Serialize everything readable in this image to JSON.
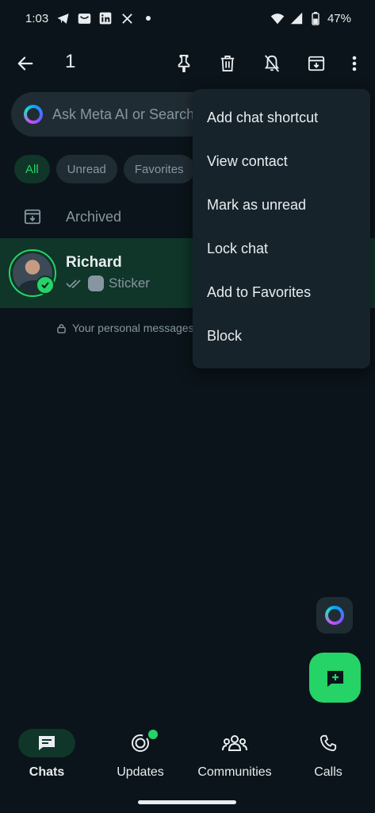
{
  "status_bar": {
    "time": "1:03",
    "battery": "47%",
    "notification_icons": [
      "telegram-icon",
      "mail-icon",
      "linkedin-icon",
      "x-icon",
      "dot-icon"
    ]
  },
  "action_bar": {
    "selected_count": "1",
    "actions": [
      "back-icon",
      "pin-icon",
      "delete-icon",
      "mute-icon",
      "archive-icon",
      "more-icon"
    ]
  },
  "search": {
    "placeholder": "Ask Meta AI or Search"
  },
  "filters": [
    "All",
    "Unread",
    "Favorites"
  ],
  "archived": {
    "label": "Archived"
  },
  "chat": {
    "name": "Richard",
    "preview": "Sticker"
  },
  "encryption_note": "Your personal messages",
  "menu": {
    "items": [
      "Add chat shortcut",
      "View contact",
      "Mark as unread",
      "Lock chat",
      "Add to Favorites",
      "Block"
    ]
  },
  "bottom_nav": {
    "items": [
      "Chats",
      "Updates",
      "Communities",
      "Calls"
    ]
  },
  "colors": {
    "background": "#0b141a",
    "accent": "#25d366",
    "selected_row": "#103529",
    "surface": "#202c33",
    "menu": "#16232b",
    "secondary_text": "#8696a0"
  }
}
